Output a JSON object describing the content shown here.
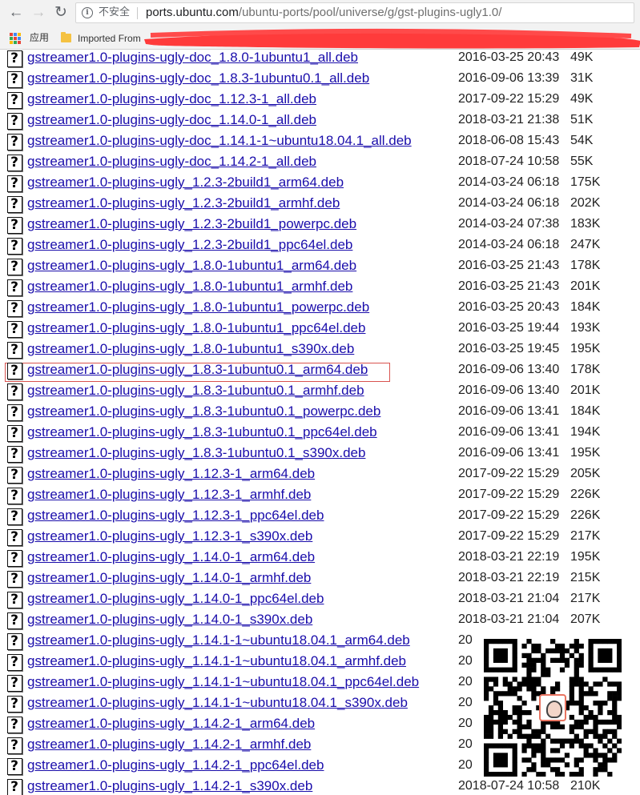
{
  "browser": {
    "back_icon": "arrow-left-icon",
    "forward_icon": "arrow-right-icon",
    "reload_icon": "reload-icon",
    "security_label": "不安全",
    "url_host": "ports.ubuntu.com",
    "url_path": "/ubuntu-ports/pool/universe/g/gst-plugins-ugly1.0/",
    "bookmarks": {
      "apps_label": "应用",
      "imported_label": "Imported From"
    }
  },
  "listing": {
    "highlighted_row": 15,
    "highlight_color": "#d9534f",
    "link_color": "#1a0dab",
    "rows": [
      {
        "name": "gstreamer1.0-plugins-ugly-doc_1.8.0-1ubuntu1_all.deb",
        "date": "2016-03-25 20:43",
        "size": "49K"
      },
      {
        "name": "gstreamer1.0-plugins-ugly-doc_1.8.3-1ubuntu0.1_all.deb",
        "date": "2016-09-06 13:39",
        "size": "31K"
      },
      {
        "name": "gstreamer1.0-plugins-ugly-doc_1.12.3-1_all.deb",
        "date": "2017-09-22 15:29",
        "size": "49K"
      },
      {
        "name": "gstreamer1.0-plugins-ugly-doc_1.14.0-1_all.deb",
        "date": "2018-03-21 21:38",
        "size": "51K"
      },
      {
        "name": "gstreamer1.0-plugins-ugly-doc_1.14.1-1~ubuntu18.04.1_all.deb",
        "date": "2018-06-08 15:43",
        "size": "54K"
      },
      {
        "name": "gstreamer1.0-plugins-ugly-doc_1.14.2-1_all.deb",
        "date": "2018-07-24 10:58",
        "size": "55K"
      },
      {
        "name": "gstreamer1.0-plugins-ugly_1.2.3-2build1_arm64.deb",
        "date": "2014-03-24 06:18",
        "size": "175K"
      },
      {
        "name": "gstreamer1.0-plugins-ugly_1.2.3-2build1_armhf.deb",
        "date": "2014-03-24 06:18",
        "size": "202K"
      },
      {
        "name": "gstreamer1.0-plugins-ugly_1.2.3-2build1_powerpc.deb",
        "date": "2014-03-24 07:38",
        "size": "183K"
      },
      {
        "name": "gstreamer1.0-plugins-ugly_1.2.3-2build1_ppc64el.deb",
        "date": "2014-03-24 06:18",
        "size": "247K"
      },
      {
        "name": "gstreamer1.0-plugins-ugly_1.8.0-1ubuntu1_arm64.deb",
        "date": "2016-03-25 21:43",
        "size": "178K"
      },
      {
        "name": "gstreamer1.0-plugins-ugly_1.8.0-1ubuntu1_armhf.deb",
        "date": "2016-03-25 21:43",
        "size": "201K"
      },
      {
        "name": "gstreamer1.0-plugins-ugly_1.8.0-1ubuntu1_powerpc.deb",
        "date": "2016-03-25 20:43",
        "size": "184K"
      },
      {
        "name": "gstreamer1.0-plugins-ugly_1.8.0-1ubuntu1_ppc64el.deb",
        "date": "2016-03-25 19:44",
        "size": "193K"
      },
      {
        "name": "gstreamer1.0-plugins-ugly_1.8.0-1ubuntu1_s390x.deb",
        "date": "2016-03-25 19:45",
        "size": "195K"
      },
      {
        "name": "gstreamer1.0-plugins-ugly_1.8.3-1ubuntu0.1_arm64.deb",
        "date": "2016-09-06 13:40",
        "size": "178K"
      },
      {
        "name": "gstreamer1.0-plugins-ugly_1.8.3-1ubuntu0.1_armhf.deb",
        "date": "2016-09-06 13:40",
        "size": "201K"
      },
      {
        "name": "gstreamer1.0-plugins-ugly_1.8.3-1ubuntu0.1_powerpc.deb",
        "date": "2016-09-06 13:41",
        "size": "184K"
      },
      {
        "name": "gstreamer1.0-plugins-ugly_1.8.3-1ubuntu0.1_ppc64el.deb",
        "date": "2016-09-06 13:41",
        "size": "194K"
      },
      {
        "name": "gstreamer1.0-plugins-ugly_1.8.3-1ubuntu0.1_s390x.deb",
        "date": "2016-09-06 13:41",
        "size": "195K"
      },
      {
        "name": "gstreamer1.0-plugins-ugly_1.12.3-1_arm64.deb",
        "date": "2017-09-22 15:29",
        "size": "205K"
      },
      {
        "name": "gstreamer1.0-plugins-ugly_1.12.3-1_armhf.deb",
        "date": "2017-09-22 15:29",
        "size": "226K"
      },
      {
        "name": "gstreamer1.0-plugins-ugly_1.12.3-1_ppc64el.deb",
        "date": "2017-09-22 15:29",
        "size": "226K"
      },
      {
        "name": "gstreamer1.0-plugins-ugly_1.12.3-1_s390x.deb",
        "date": "2017-09-22 15:29",
        "size": "217K"
      },
      {
        "name": "gstreamer1.0-plugins-ugly_1.14.0-1_arm64.deb",
        "date": "2018-03-21 22:19",
        "size": "195K"
      },
      {
        "name": "gstreamer1.0-plugins-ugly_1.14.0-1_armhf.deb",
        "date": "2018-03-21 22:19",
        "size": "215K"
      },
      {
        "name": "gstreamer1.0-plugins-ugly_1.14.0-1_ppc64el.deb",
        "date": "2018-03-21 21:04",
        "size": "217K"
      },
      {
        "name": "gstreamer1.0-plugins-ugly_1.14.0-1_s390x.deb",
        "date": "2018-03-21 21:04",
        "size": "207K"
      },
      {
        "name": "gstreamer1.0-plugins-ugly_1.14.1-1~ubuntu18.04.1_arm64.deb",
        "date": "20",
        "size": ""
      },
      {
        "name": "gstreamer1.0-plugins-ugly_1.14.1-1~ubuntu18.04.1_armhf.deb",
        "date": "20",
        "size": ""
      },
      {
        "name": "gstreamer1.0-plugins-ugly_1.14.1-1~ubuntu18.04.1_ppc64el.deb",
        "date": "20",
        "size": ""
      },
      {
        "name": "gstreamer1.0-plugins-ugly_1.14.1-1~ubuntu18.04.1_s390x.deb",
        "date": "20",
        "size": ""
      },
      {
        "name": "gstreamer1.0-plugins-ugly_1.14.2-1_arm64.deb",
        "date": "20",
        "size": ""
      },
      {
        "name": "gstreamer1.0-plugins-ugly_1.14.2-1_armhf.deb",
        "date": "20",
        "size": ""
      },
      {
        "name": "gstreamer1.0-plugins-ugly_1.14.2-1_ppc64el.deb",
        "date": "20",
        "size": ""
      },
      {
        "name": "gstreamer1.0-plugins-ugly_1.14.2-1_s390x.deb",
        "date": "2018-07-24 10:58",
        "size": "210K"
      }
    ]
  }
}
